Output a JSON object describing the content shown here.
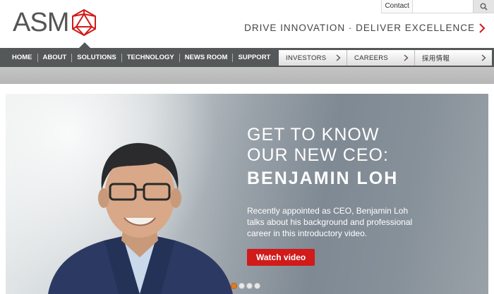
{
  "header": {
    "logo_text": "ASM",
    "contact_label": "Contact",
    "search_placeholder": "",
    "tagline": "DRIVE INNOVATION · DELIVER EXCELLENCE"
  },
  "nav": {
    "items": [
      {
        "label": "HOME"
      },
      {
        "label": "ABOUT"
      },
      {
        "label": "SOLUTIONS"
      },
      {
        "label": "TECHNOLOGY"
      },
      {
        "label": "NEWS ROOM"
      },
      {
        "label": "SUPPORT"
      }
    ],
    "tabs": [
      {
        "label": "INVESTORS"
      },
      {
        "label": "CAREERS"
      },
      {
        "label": "採用情報"
      }
    ]
  },
  "hero": {
    "title_line1": "GET TO KNOW",
    "title_line2": "OUR NEW CEO:",
    "name": "BENJAMIN LOH",
    "description": "Recently appointed as CEO, Benjamin Loh talks about his background and professional career in this introductory video.",
    "button_label": "Watch video",
    "slides_total": 4,
    "active_slide": 1
  },
  "colors": {
    "brand_red": "#d11a1a",
    "nav_gray": "#555859",
    "dot_active": "#e07a1f"
  },
  "icons": {
    "logo_mark": "asm-logo-icon",
    "search": "search-icon",
    "tagline_arrow": "chevron-right-icon",
    "tab_arrow": "chevron-right-icon"
  }
}
